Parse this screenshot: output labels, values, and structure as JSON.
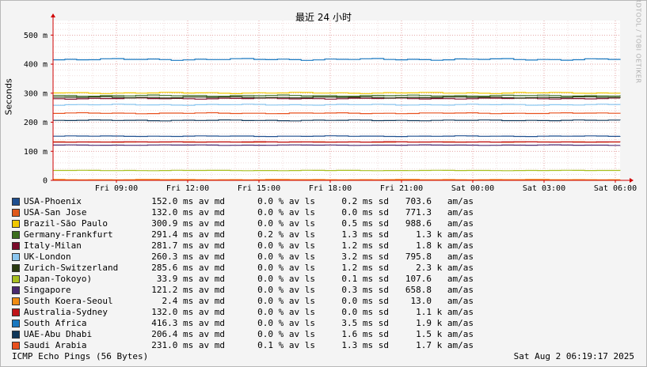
{
  "chart_data": {
    "type": "line",
    "title": "最近 24 小时",
    "ylabel": "Seconds",
    "ylim": [
      0,
      0.55
    ],
    "yticks": [
      {
        "value": 0,
        "label": "0"
      },
      {
        "value": 0.1,
        "label": "100 m"
      },
      {
        "value": 0.2,
        "label": "200 m"
      },
      {
        "value": 0.3,
        "label": "300 m"
      },
      {
        "value": 0.4,
        "label": "400 m"
      },
      {
        "value": 0.5,
        "label": "500 m"
      }
    ],
    "xticks": [
      "Fri 09:00",
      "Fri 12:00",
      "Fri 15:00",
      "Fri 18:00",
      "Fri 21:00",
      "Sat 00:00",
      "Sat 03:00",
      "Sat 06:00"
    ],
    "series": [
      {
        "name": "USA-Phoenix",
        "color": "#1f4f8f",
        "value": 0.152,
        "avg": "152.0 ms av md",
        "loss": "0.0 % av ls",
        "sd": "0.2 ms sd",
        "ams": "703.6   am/as"
      },
      {
        "name": "USA-San Jose",
        "color": "#e05a1c",
        "value": 0.132,
        "avg": "132.0 ms av md",
        "loss": "0.0 % av ls",
        "sd": "0.0 ms sd",
        "ams": "771.3   am/as"
      },
      {
        "name": "Brazil-São Paulo",
        "color": "#f0c800",
        "value": 0.3009,
        "avg": "300.9 ms av md",
        "loss": "0.0 % av ls",
        "sd": "0.5 ms sd",
        "ams": "988.6   am/as"
      },
      {
        "name": "Germany-Frankfurt",
        "color": "#3c6e1e",
        "value": 0.2914,
        "avg": "291.4 ms av md",
        "loss": "0.2 % av ls",
        "sd": "1.3 ms sd",
        "ams": "1.3 k am/as"
      },
      {
        "name": "Italy-Milan",
        "color": "#7a0a2a",
        "value": 0.2817,
        "avg": "281.7 ms av md",
        "loss": "0.0 % av ls",
        "sd": "1.2 ms sd",
        "ams": "1.8 k am/as"
      },
      {
        "name": "UK-London",
        "color": "#8ac6f0",
        "value": 0.2603,
        "avg": "260.3 ms av md",
        "loss": "0.0 % av ls",
        "sd": "3.2 ms sd",
        "ams": "795.8   am/as"
      },
      {
        "name": "Zurich-Switzerland",
        "color": "#2a3a10",
        "value": 0.2856,
        "avg": "285.6 ms av md",
        "loss": "0.0 % av ls",
        "sd": "1.2 ms sd",
        "ams": "2.3 k am/as"
      },
      {
        "name": "Japan-Tokoyo)",
        "color": "#a8c020",
        "value": 0.0339,
        "avg": "33.9 ms av md",
        "loss": "0.0 % av ls",
        "sd": "0.1 ms sd",
        "ams": "107.6   am/as"
      },
      {
        "name": "Singapore",
        "color": "#4a2a70",
        "value": 0.1212,
        "avg": "121.2 ms av md",
        "loss": "0.0 % av ls",
        "sd": "0.3 ms sd",
        "ams": "658.8   am/as"
      },
      {
        "name": "South Koera-Seoul",
        "color": "#f08c14",
        "value": 0.0024,
        "avg": "2.4 ms av md",
        "loss": "0.0 % av ls",
        "sd": "0.0 ms sd",
        "ams": "13.0   am/as"
      },
      {
        "name": "Australia-Sydney",
        "color": "#c01418",
        "value": 0.132,
        "avg": "132.0 ms av md",
        "loss": "0.0 % av ls",
        "sd": "0.0 ms sd",
        "ams": "1.1 k am/as"
      },
      {
        "name": "South Africa",
        "color": "#1a78c0",
        "value": 0.4163,
        "avg": "416.3 ms av md",
        "loss": "0.0 % av ls",
        "sd": "3.5 ms sd",
        "ams": "1.9 k am/as"
      },
      {
        "name": "UAE-Abu Dhabi",
        "color": "#10385a",
        "value": 0.2064,
        "avg": "206.4 ms av md",
        "loss": "0.0 % av ls",
        "sd": "1.6 ms sd",
        "ams": "1.5 k am/as"
      },
      {
        "name": "Saudi Arabia",
        "color": "#e8501e",
        "value": 0.231,
        "avg": "231.0 ms av md",
        "loss": "0.1 % av ls",
        "sd": "1.3 ms sd",
        "ams": "1.7 k am/as"
      }
    ]
  },
  "watermark": "RRDTOOL / TOBI OETIKER",
  "footer": {
    "left": "ICMP Echo Pings (56 Bytes)",
    "right": "Sat Aug  2 06:19:17 2025"
  }
}
